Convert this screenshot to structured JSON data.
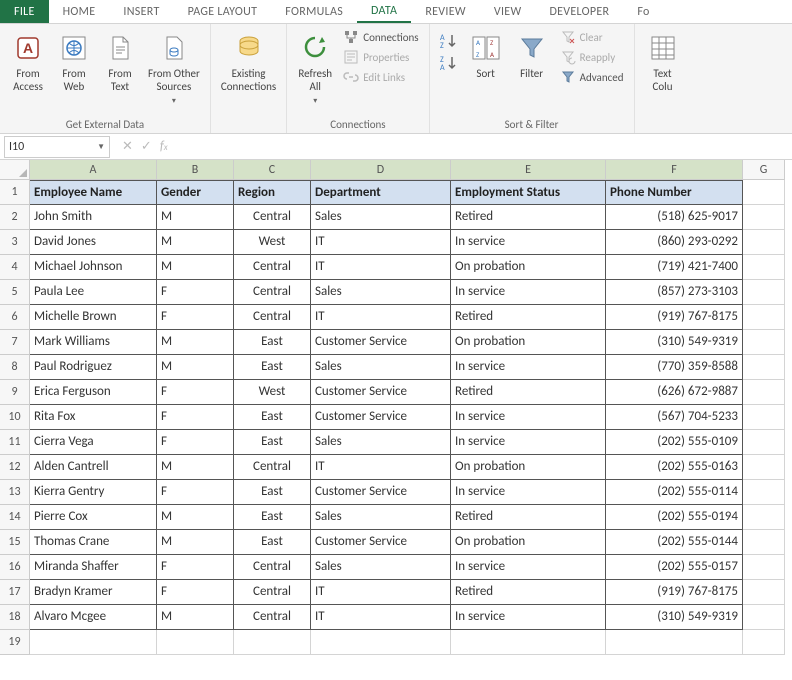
{
  "tabs": {
    "file": "FILE",
    "home": "HOME",
    "insert": "INSERT",
    "pagelayout": "PAGE LAYOUT",
    "formulas": "FORMULAS",
    "data": "DATA",
    "review": "REVIEW",
    "view": "VIEW",
    "developer": "DEVELOPER",
    "extra": "Fo"
  },
  "ribbon": {
    "getexternal": {
      "label": "Get External Data",
      "access": "From\nAccess",
      "web": "From\nWeb",
      "text": "From\nText",
      "other": "From Other\nSources"
    },
    "existing": "Existing\nConnections",
    "connections": {
      "label": "Connections",
      "refresh": "Refresh\nAll",
      "connections": "Connections",
      "properties": "Properties",
      "editlinks": "Edit Links"
    },
    "sortfilter": {
      "label": "Sort & Filter",
      "sort": "Sort",
      "filter": "Filter",
      "clear": "Clear",
      "reapply": "Reapply",
      "advanced": "Advanced"
    },
    "texttocol": "Text\nColu"
  },
  "namebox": "I10",
  "columns": [
    "A",
    "B",
    "C",
    "D",
    "E",
    "F",
    "G"
  ],
  "header_row": [
    "Employee Name",
    "Gender",
    "Region",
    "Department",
    "Employment Status",
    "Phone Number"
  ],
  "rows": [
    [
      "John Smith",
      "M",
      "Central",
      "Sales",
      "Retired",
      "(518) 625-9017"
    ],
    [
      "David Jones",
      "M",
      "West",
      "IT",
      "In service",
      "(860) 293-0292"
    ],
    [
      "Michael Johnson",
      "M",
      "Central",
      "IT",
      "On probation",
      "(719) 421-7400"
    ],
    [
      "Paula Lee",
      "F",
      "Central",
      "Sales",
      "In service",
      "(857) 273-3103"
    ],
    [
      "Michelle Brown",
      "F",
      "Central",
      "IT",
      "Retired",
      "(919) 767-8175"
    ],
    [
      "Mark Williams",
      "M",
      "East",
      "Customer Service",
      "On probation",
      "(310) 549-9319"
    ],
    [
      "Paul Rodriguez",
      "M",
      "East",
      "Sales",
      "In service",
      "(770) 359-8588"
    ],
    [
      "Erica Ferguson",
      "F",
      "West",
      "Customer Service",
      "Retired",
      "(626) 672-9887"
    ],
    [
      "Rita Fox",
      "F",
      "East",
      "Customer Service",
      "In service",
      "(567) 704-5233"
    ],
    [
      "Cierra Vega",
      "F",
      "East",
      "Sales",
      "In service",
      "(202) 555-0109"
    ],
    [
      "Alden Cantrell",
      "M",
      "Central",
      "IT",
      "On probation",
      "(202) 555-0163"
    ],
    [
      "Kierra Gentry",
      "F",
      "East",
      "Customer Service",
      "In service",
      "(202) 555-0114"
    ],
    [
      "Pierre Cox",
      "M",
      "East",
      "Sales",
      "Retired",
      "(202) 555-0194"
    ],
    [
      "Thomas Crane",
      "M",
      "East",
      "Customer Service",
      "On probation",
      "(202) 555-0144"
    ],
    [
      "Miranda Shaffer",
      "F",
      "Central",
      "Sales",
      "In service",
      "(202) 555-0157"
    ],
    [
      "Bradyn Kramer",
      "F",
      "Central",
      "IT",
      "Retired",
      "(919) 767-8175"
    ],
    [
      "Alvaro Mcgee",
      "M",
      "Central",
      "IT",
      "In service",
      "(310) 549-9319"
    ]
  ]
}
